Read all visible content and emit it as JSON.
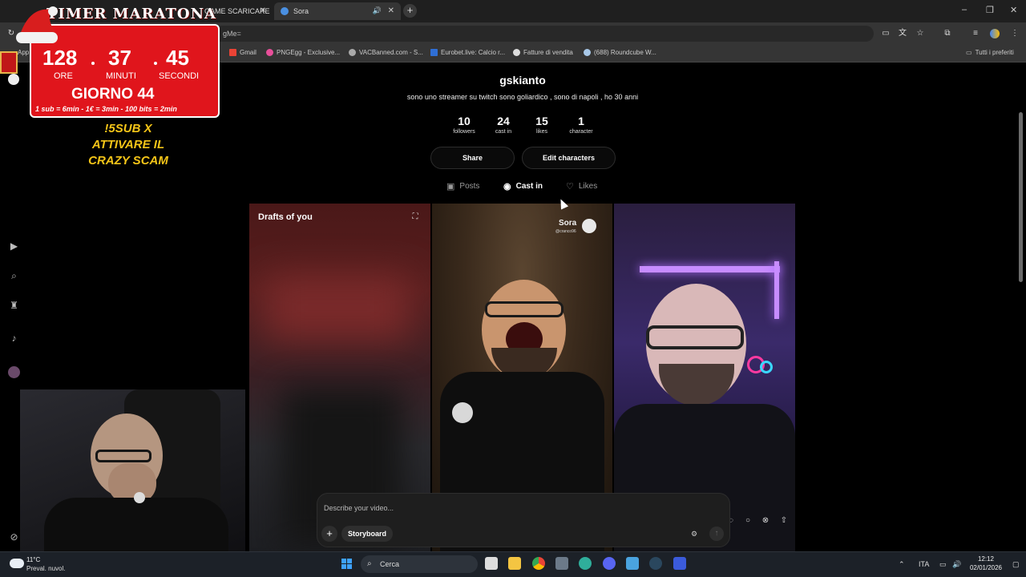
{
  "browser": {
    "tabs": [
      {
        "label": "GAME SCARICARE"
      },
      {
        "label": "Sora"
      }
    ],
    "url": "gMe=",
    "bookmarks": [
      {
        "label": "Gmail",
        "icon": "gmail-icon"
      },
      {
        "label": "PNGEgg - Exclusive...",
        "icon": "pngegg-icon"
      },
      {
        "label": "VACBanned.com - S...",
        "icon": "vacbanned-icon"
      },
      {
        "label": "Eurobet.live: Calcio r...",
        "icon": "eurobet-icon"
      },
      {
        "label": "Fatture di vendita",
        "icon": "invoice-icon"
      },
      {
        "label": "(688) Roundcube W...",
        "icon": "roundcube-icon"
      }
    ],
    "all_bookmarks": "Tutti i preferiti",
    "bm_cut": "App"
  },
  "profile": {
    "username": "gskianto",
    "bio": "sono uno streamer su twitch sono goliardico , sono di napoli , ho 30 anni",
    "stats": [
      {
        "value": "10",
        "label": "followers"
      },
      {
        "value": "24",
        "label": "cast in"
      },
      {
        "value": "15",
        "label": "likes"
      },
      {
        "value": "1",
        "label": "character"
      }
    ],
    "buttons": {
      "share": "Share",
      "edit": "Edit characters"
    },
    "tabs": [
      {
        "label": "Posts",
        "icon": "play-square-icon"
      },
      {
        "label": "Cast in",
        "icon": "user-circle-icon"
      },
      {
        "label": "Likes",
        "icon": "heart-icon"
      }
    ]
  },
  "grid": {
    "drafts_label": "Drafts of you",
    "watermark": "Sora",
    "watermark_handle": "@cranco96"
  },
  "composer": {
    "placeholder": "Describe your video...",
    "storyboard": "Storyboard"
  },
  "overlay": {
    "timer_title": "TIMER MARATONA",
    "hours": "128",
    "minutes": "37",
    "seconds": "45",
    "hours_label": "ORE",
    "minutes_label": "MINUTI",
    "seconds_label": "SECONDI",
    "day": "GIORNO 44",
    "rates": "1 sub = 6min - 1€ = 3min - 100 bits = 2min",
    "line1": "!5SUB X",
    "line2": "ATTIVARE IL",
    "line3": "CRAZY SCAM",
    "colors": {
      "panel": "#e0151c",
      "text": "#f5c518"
    }
  },
  "taskbar": {
    "temperature": "11°C",
    "weather": "Preval. nuvol.",
    "search": "Cerca",
    "lang": "ITA",
    "time": "12:12",
    "date": "02/01/2026"
  }
}
